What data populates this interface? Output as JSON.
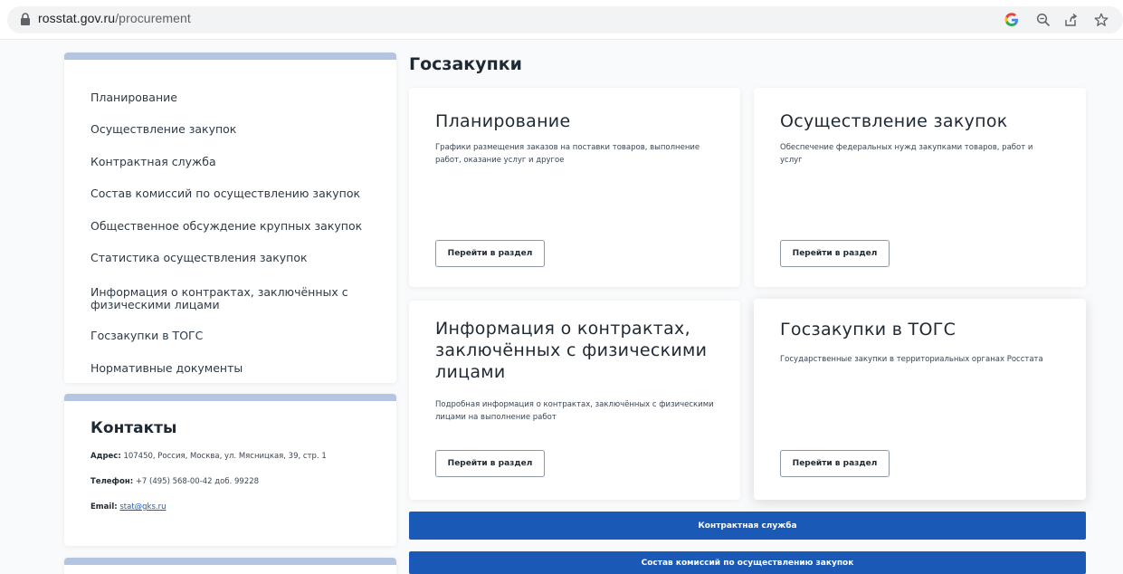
{
  "browser": {
    "url_host": "rosstat.gov.ru",
    "url_path": "/procurement",
    "icons": [
      "lock-icon",
      "google-icon",
      "zoom-icon",
      "share-icon",
      "star-icon"
    ]
  },
  "sidebar": {
    "items": [
      {
        "label": "Планирование"
      },
      {
        "label": "Осуществление закупок"
      },
      {
        "label": "Контрактная служба"
      },
      {
        "label": "Состав комиссий по осуществлению закупок"
      },
      {
        "label": "Общественное обсуждение крупных закупок"
      },
      {
        "label": "Статистика осуществления закупок"
      },
      {
        "label": "Информация о контрактах, заключённых с физическими лицами"
      },
      {
        "label": "Госзакупки в ТОГС"
      },
      {
        "label": "Нормативные документы"
      }
    ]
  },
  "contacts": {
    "title": "Контакты",
    "address_label": "Адрес:",
    "address_value": "107450, Россия, Москва, ул. Мясницкая, 39, стр. 1",
    "phone_label": "Телефон:",
    "phone_value": "+7 (495) 568-00-42 доб. 99228",
    "email_label": "Email:",
    "email_value": "stat@gks.ru"
  },
  "main": {
    "title": "Госзакупки",
    "cards": [
      {
        "title": "Планирование",
        "description": "Графики размещения заказов на поставки товаров, выполнение работ, оказание услуг и другое",
        "button": "Перейти в раздел"
      },
      {
        "title": "Осуществление закупок",
        "description": "Обеспечение федеральных нужд закупками товаров, работ и услуг",
        "button": "Перейти в раздел"
      },
      {
        "title": "Информация о контрактах, заключённых с физическими лицами",
        "description": "Подробная информация о контрактах, заключённых с физическими лицами на выполнение работ",
        "button": "Перейти в раздел"
      },
      {
        "title": "Госзакупки в ТОГС",
        "description": "Государственные закупки в территориальных органах Росстата",
        "button": "Перейти в раздел"
      }
    ],
    "wide_buttons": [
      {
        "label": "Контрактная служба"
      },
      {
        "label": "Состав комиссий по осуществлению закупок"
      }
    ]
  },
  "colors": {
    "accent": "#1a5ab6",
    "sidebar_bar": "#b4c5e4",
    "google_blue": "#4285f4"
  }
}
